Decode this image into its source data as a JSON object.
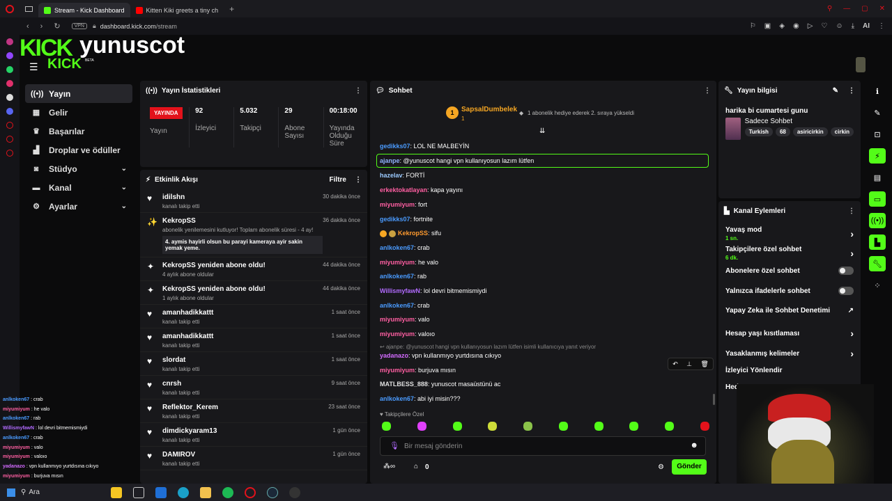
{
  "browser": {
    "tabs": [
      {
        "title": "Stream - Kick Dashboard",
        "active": true
      },
      {
        "title": "Kitten Kiki greets a tiny ch",
        "active": false
      }
    ],
    "vpn": "VPN",
    "url_host": "dashboard.kick.com",
    "url_path": "/stream",
    "ai_label": "AI"
  },
  "header": {
    "logo": "KICK",
    "logo_small": "KICK",
    "beta": "BETA",
    "username": "yunuscot"
  },
  "nav": {
    "items": [
      {
        "label": "Yayın",
        "icon": "broadcast-icon"
      },
      {
        "label": "Gelir",
        "icon": "revenue-icon"
      },
      {
        "label": "Başarılar",
        "icon": "trophy-icon"
      },
      {
        "label": "Droplar ve ödüller",
        "icon": "gift-icon"
      },
      {
        "label": "Stüdyo",
        "icon": "studio-icon"
      },
      {
        "label": "Kanal",
        "icon": "channel-icon"
      },
      {
        "label": "Ayarlar",
        "icon": "gear-icon"
      }
    ]
  },
  "stats": {
    "title": "Yayın İstatistikleri",
    "live_label": "YAYINDA",
    "items": [
      {
        "value": "92",
        "label": "İzleyici"
      },
      {
        "value": "5.032",
        "label": "Takipçi"
      },
      {
        "value": "29",
        "label": "Abone Sayısı"
      },
      {
        "value": "00:18:00",
        "label": "Yayında Olduğu Süre"
      }
    ],
    "first_label": "Yayın"
  },
  "activity": {
    "title": "Etkinlik Akışı",
    "filter": "Filtre",
    "items": [
      {
        "name": "idilshn",
        "sub": "kanalı takip etti",
        "time": "30 dakika önce",
        "icon": "heart-icon"
      },
      {
        "name": "KekropSS",
        "sub": "abonelik yenilemesini kutluyor! Toplam abonelik süresi - 4 ay!",
        "time": "36 dakika önce",
        "icon": "confetti-icon",
        "message": "4. aymis hayirli olsun bu parayi kameraya ayir sakin yemak yeme."
      },
      {
        "name": "KekropSS yeniden abone oldu!",
        "sub": "4 aylık abone oldular",
        "time": "44 dakika önce",
        "icon": "sparkle-icon"
      },
      {
        "name": "KekropSS yeniden abone oldu!",
        "sub": "1 aylık abone oldular",
        "time": "44 dakika önce",
        "icon": "sparkle-icon"
      },
      {
        "name": "amanhadikkattt",
        "sub": "kanalı takip etti",
        "time": "1 saat önce",
        "icon": "heart-icon"
      },
      {
        "name": "amanhadikkattt",
        "sub": "kanalı takip etti",
        "time": "1 saat önce",
        "icon": "heart-icon"
      },
      {
        "name": "slordat",
        "sub": "kanalı takip etti",
        "time": "1 saat önce",
        "icon": "heart-icon"
      },
      {
        "name": "cnrsh",
        "sub": "kanalı takip etti",
        "time": "9 saat önce",
        "icon": "heart-icon"
      },
      {
        "name": "Reflektor_Kerem",
        "sub": "kanalı takip etti",
        "time": "23 saat önce",
        "icon": "heart-icon"
      },
      {
        "name": "dimdickyaram13",
        "sub": "kanalı takip etti",
        "time": "1 gün önce",
        "icon": "heart-icon"
      },
      {
        "name": "DAMIROV",
        "sub": "kanalı takip etti",
        "time": "1 gün önce",
        "icon": "heart-icon"
      }
    ]
  },
  "chat": {
    "title": "Sohbet",
    "pinned_user": "SapsalDumbelek",
    "pinned_count": "1",
    "pinned_text": "1 abonelik hediye ederek 2. sıraya yükseldi",
    "messages": [
      {
        "user": "gedikks07",
        "text": "LOL NE MALBEYİN",
        "color": "#4a9bff"
      },
      {
        "user": "ajanpe",
        "text": "@yunuscot hangi vpn kullanıyosun lazım lütfen",
        "color": "#8fb3ff",
        "highlight": true
      },
      {
        "user": "hazelav",
        "text": "FORTİ",
        "color": "#9ccbff"
      },
      {
        "user": "erkektokatlayan",
        "text": "kapa yayını",
        "color": "#ff5fa2"
      },
      {
        "user": "miyumiyum",
        "text": "fort",
        "color": "#ff5fa2"
      },
      {
        "user": "gedikks07",
        "text": "fortnite",
        "color": "#4a9bff"
      },
      {
        "user": "KekropSS",
        "text": "sifu",
        "color": "#ff9b2f"
      },
      {
        "user": "anlkoken67",
        "text": "crab",
        "color": "#4a9bff"
      },
      {
        "user": "miyumiyum",
        "text": "he valo",
        "color": "#ff5fa2"
      },
      {
        "user": "anlkoken67",
        "text": "rab",
        "color": "#4a9bff"
      },
      {
        "user": "WillismyfawN",
        "text": "lol devri bitmemismiydi",
        "color": "#b26bff"
      },
      {
        "user": "anlkoken67",
        "text": "crab",
        "color": "#4a9bff"
      },
      {
        "user": "miyumiyum",
        "text": "valo",
        "color": "#ff5fa2"
      },
      {
        "user": "miyumiyum",
        "text": "valoıo",
        "color": "#ff5fa2"
      },
      {
        "user": "yadanazo",
        "text": "vpn kullanmıyo yurtdısına cıkıyo",
        "color": "#d36bff"
      },
      {
        "user": "miyumiyum",
        "text": "burjuva mısın",
        "color": "#ff5fa2"
      },
      {
        "user": "MATLBESS_888",
        "text": "yunuscot masaüstünü ac",
        "color": "#e0e0e0"
      },
      {
        "user": "anlkoken67",
        "text": "abi iyi misin???",
        "color": "#4a9bff"
      }
    ],
    "reply_text": "ajanpe: @yunuscot hangi vpn kullanıyosun lazım lütfen isimli kullanıcıya yanıt veriyor",
    "followers_only": "Takipçilere Özel",
    "input_placeholder": "Bir mesaj gönderin",
    "points": "0",
    "send": "Gönder"
  },
  "stream_info": {
    "title": "Yayın bilgisi",
    "stream_title": "harika bi cumartesi gunu",
    "category": "Sadece Sohbet",
    "tags": [
      "Turkish",
      "68",
      "asiricirkin",
      "cirkin"
    ]
  },
  "channel_actions": {
    "title": "Kanal Eylemleri",
    "items": [
      {
        "label": "Yavaş mod",
        "sub": "1 sn.",
        "type": "chevron"
      },
      {
        "label": "Takipçilere özel sohbet",
        "sub": "6 dk.",
        "type": "chevron"
      },
      {
        "label": "Abonelere özel sohbet",
        "sub": "",
        "type": "toggle"
      },
      {
        "label": "Yalnızca ifadelerle sohbet",
        "sub": "",
        "type": "toggle"
      },
      {
        "label": "Yapay Zeka ile Sohbet Denetimi",
        "sub": "",
        "type": "external"
      },
      {
        "label": "Hesap yaşı kısıtlaması",
        "sub": "",
        "type": "chevron"
      },
      {
        "label": "Yasaklanmış kelimeler",
        "sub": "",
        "type": "chevron"
      },
      {
        "label": "İzleyici Yönlendir",
        "sub": "",
        "type": "none"
      },
      {
        "label": "Hed",
        "sub": "",
        "type": "none"
      }
    ]
  },
  "overlay_chat": [
    {
      "user": "anlkoken67",
      "text": "crab",
      "color": "#4a9bff"
    },
    {
      "user": "miyumiyum",
      "text": "he valo",
      "color": "#ff5fa2"
    },
    {
      "user": "anlkoken67",
      "text": "rab",
      "color": "#4a9bff"
    },
    {
      "user": "WillismyfawN",
      "text": "lol devri bitmemismiydi",
      "color": "#b26bff"
    },
    {
      "user": "anlkoken67",
      "text": "crab",
      "color": "#4a9bff"
    },
    {
      "user": "miyumiyum",
      "text": "valo",
      "color": "#ff5fa2"
    },
    {
      "user": "miyumiyum",
      "text": "valoıo",
      "color": "#ff5fa2"
    },
    {
      "user": "yadanazo",
      "text": "vpn kullanmıyo yurtdısına cıkıyo",
      "color": "#d36bff"
    },
    {
      "user": "miyumiyum",
      "text": "burjuva mısın",
      "color": "#ff5fa2"
    }
  ],
  "taskbar": {
    "search": "Ara"
  },
  "colors": {
    "accent": "#53fc18",
    "live": "#e3121b",
    "panel": "#18181b"
  }
}
